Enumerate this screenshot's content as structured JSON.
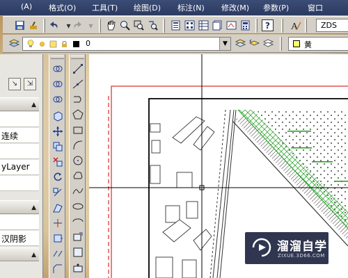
{
  "menubar": {
    "items": [
      "(A)",
      "格式(O)",
      "工具(T)",
      "绘图(D)",
      "标注(N)",
      "修改(M)",
      "参数(P)",
      "窗口"
    ]
  },
  "toolbar": {
    "icons": [
      "save-icon",
      "match-properties-icon",
      "undo-icon",
      "redo-icon",
      "pan-icon",
      "zoom-realtime-icon",
      "zoom-window-icon",
      "zoom-previous-icon",
      "properties-icon",
      "design-center-icon",
      "tool-palettes-icon",
      "sheet-set-icon",
      "markup-icon",
      "quickcalc-icon",
      "help-icon",
      "text-style-icon"
    ],
    "text_style_value": "ZDS"
  },
  "layers": {
    "current_layer": "0",
    "color_value": "黄"
  },
  "properties_panel": {
    "rows": [
      "连续",
      "yLayer",
      "汉阴影"
    ]
  },
  "watermark": {
    "title": "溜溜自学",
    "url": "ZIXUE.3D66.COM"
  },
  "drawing": {
    "label_color": "#1a9c1a",
    "frame_color": "#cc0000"
  }
}
